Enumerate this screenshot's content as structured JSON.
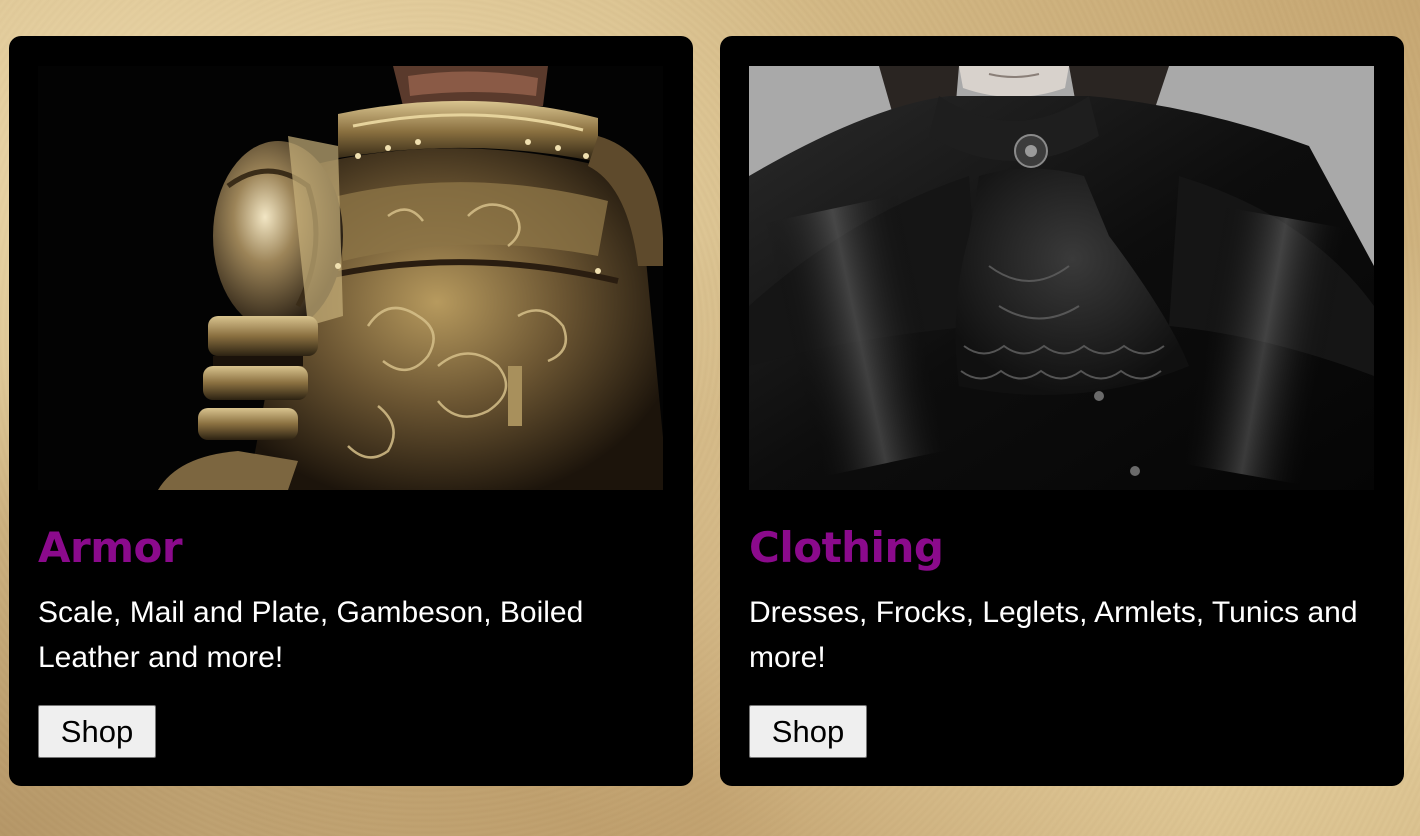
{
  "colors": {
    "title": "#8b0a8c",
    "description": "#ffffff",
    "card_background": "#000000",
    "button_background": "#efefef"
  },
  "cards": [
    {
      "title": "Armor",
      "description": "Scale, Mail and Plate, Gambeson, Boiled Leather and more!",
      "button_label": "Shop",
      "image_alt": "ornate gold plate armor"
    },
    {
      "title": "Clothing",
      "description": "Dresses, Frocks, Leglets, Armlets, Tunics and more!",
      "button_label": "Shop",
      "image_alt": "black velvet gothic coat with lace jabot"
    }
  ]
}
